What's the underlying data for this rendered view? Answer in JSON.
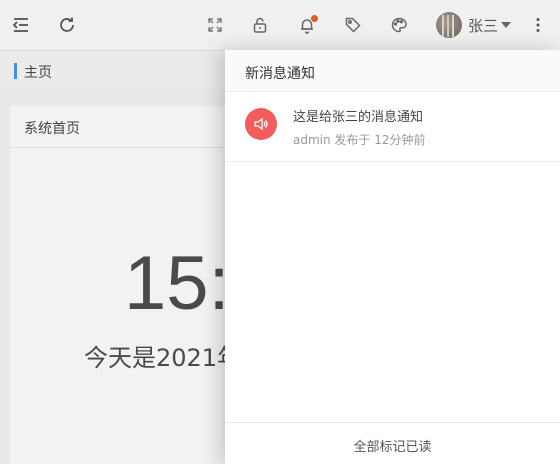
{
  "header": {
    "icons": [
      "menu-fold-icon",
      "refresh-icon",
      "fullscreen-icon",
      "lock-icon",
      "bell-icon",
      "tag-icon",
      "palette-icon",
      "more-vertical-icon"
    ],
    "notification_badge_color": "#e05a2b",
    "user": {
      "name": "张三"
    }
  },
  "tabs": [
    {
      "label": "主页",
      "active": true
    }
  ],
  "home_card": {
    "title": "系统首页",
    "clock": "15:",
    "date": "今天是2021年"
  },
  "notice_panel": {
    "title": "新消息通知",
    "items": [
      {
        "title": "这是给张三的消息通知",
        "meta": "admin 发布于 12分钟前",
        "icon": "speaker-icon",
        "icon_color": "#f25c5c"
      }
    ],
    "footer_label": "全部标记已读"
  },
  "colors": {
    "accent": "#3f8ef0"
  }
}
